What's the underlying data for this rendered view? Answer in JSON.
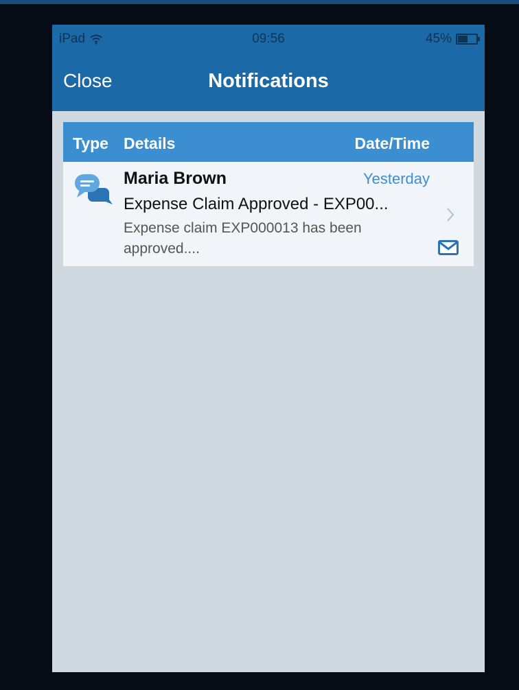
{
  "status_bar": {
    "device": "iPad",
    "time": "09:56",
    "battery": "45%",
    "icons": [
      "wifi-icon",
      "battery-icon"
    ]
  },
  "header": {
    "close_label": "Close",
    "title": "Notifications"
  },
  "table": {
    "columns": {
      "type": "Type",
      "details": "Details",
      "datetime": "Date/Time"
    },
    "rows": [
      {
        "sender": "Maria Brown",
        "timestamp": "Yesterday",
        "subject": "Expense Claim Approved - EXP00...",
        "preview": "Expense claim EXP000013 has been approved....",
        "type_icon": "chat-bubbles-icon",
        "status_icon": "mail-icon"
      }
    ]
  },
  "colors": {
    "header_blue": "#1c69a8",
    "table_header_blue": "#3b8fd0",
    "accent_blue": "#3d8ed4",
    "background": "#d0d8e0"
  }
}
